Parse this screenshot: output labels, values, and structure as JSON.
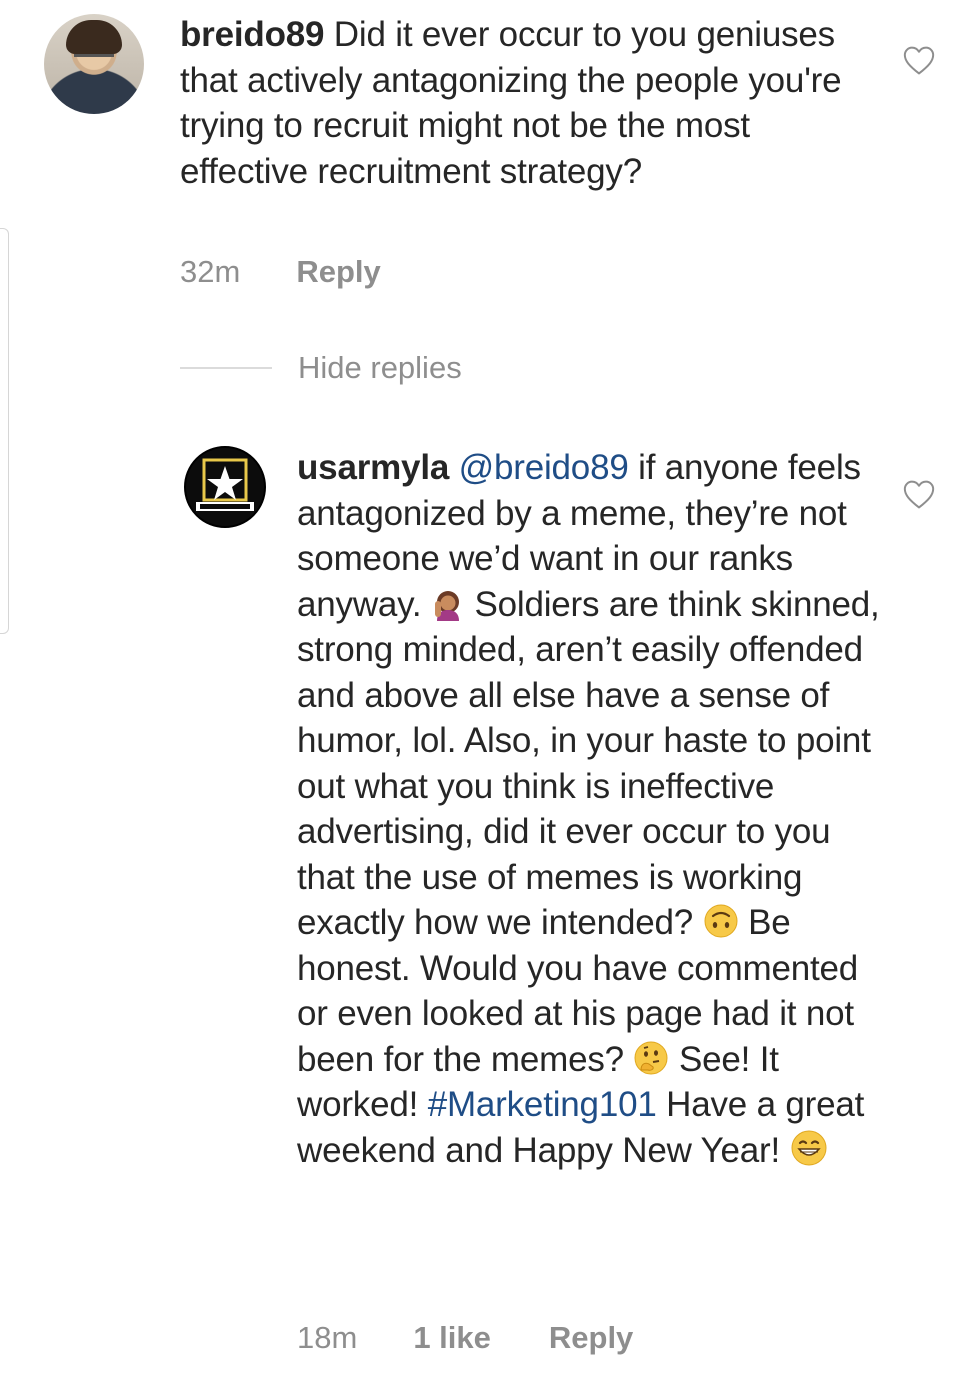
{
  "comment_1": {
    "username": "breido89",
    "text": " Did it ever occur to you geniuses that actively antagonizing the people you're trying to recruit might not be the most effective recruitment strategy?",
    "time": "32m",
    "reply_label": "Reply"
  },
  "hide_replies_label": "Hide replies",
  "comment_2": {
    "username": "usarmyla",
    "mention": "@breido89",
    "text_a": " if anyone feels antagonized by a meme, they’re not someone we’d want in our ranks anyway. ",
    "emoji_a": "woman-raising-hand-icon",
    "text_b": " Soldiers are think skinned, strong minded, aren’t easily offended and above all else have a sense of humor, lol. Also, in your haste to point out what you think is ineffective advertising, did it ever occur to you that the use of memes is working exactly how we intended? ",
    "emoji_b": "upside-down-face-icon",
    "text_c": " Be honest. Would you have commented or even looked at his page had it not been for the memes? ",
    "emoji_c": "thinking-face-icon",
    "text_d": " See! It worked! ",
    "hashtag": "#Marketing101",
    "text_e": " Have a great weekend and Happy New Year! ",
    "emoji_d": "grinning-face-icon",
    "time": "18m",
    "likes": "1 like",
    "reply_label": "Reply"
  },
  "colors": {
    "text": "#262626",
    "meta": "#8e8e8e",
    "link": "#1f4d86",
    "divider": "#dbdbdb"
  }
}
